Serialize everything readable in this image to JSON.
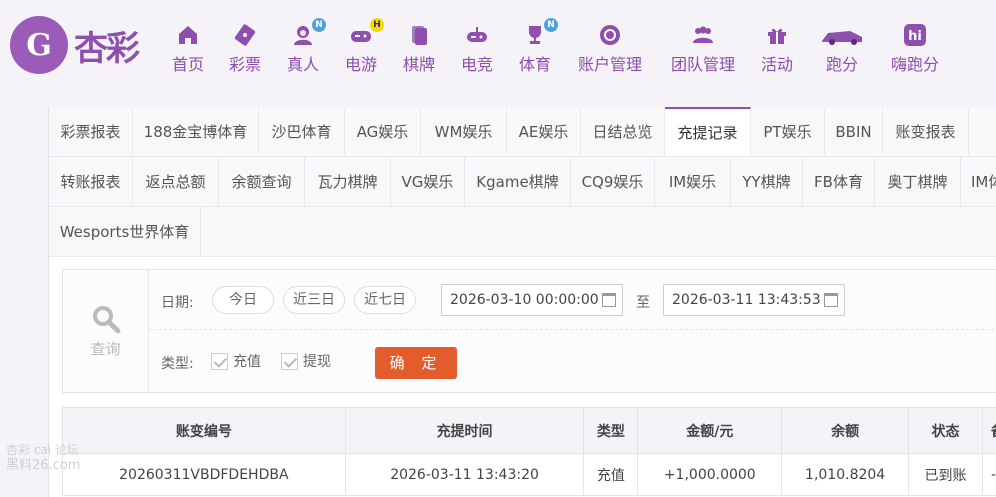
{
  "brand": {
    "name": "杏彩",
    "logo_letter": "G"
  },
  "nav": [
    {
      "label": "首页",
      "icon": "home-icon"
    },
    {
      "label": "彩票",
      "icon": "ticket-icon"
    },
    {
      "label": "真人",
      "icon": "dealer-icon",
      "badge": "N"
    },
    {
      "label": "电游",
      "icon": "gamepad-icon",
      "badge": "H"
    },
    {
      "label": "棋牌",
      "icon": "cards-icon"
    },
    {
      "label": "电竞",
      "icon": "controller-icon"
    },
    {
      "label": "体育",
      "icon": "trophy-icon",
      "badge": "N"
    },
    {
      "label": "账户管理",
      "icon": "account-icon"
    },
    {
      "label": "团队管理",
      "icon": "team-icon"
    },
    {
      "label": "活动",
      "icon": "gift-icon"
    },
    {
      "label": "跑分",
      "icon": "car-icon"
    },
    {
      "label": "嗨跑分",
      "icon": "hi-icon"
    }
  ],
  "tabs_row1": [
    "彩票报表",
    "188金宝博体育",
    "沙巴体育",
    "AG娱乐",
    "WM娱乐",
    "AE娱乐",
    "日结总览",
    "充提记录",
    "PT娱乐",
    "BBIN",
    "账变报表"
  ],
  "tabs_row2": [
    "转账报表",
    "返点总额",
    "余额查询",
    "瓦力棋牌",
    "VG娱乐",
    "Kgame棋牌",
    "CQ9娱乐",
    "IM娱乐",
    "YY棋牌",
    "FB体育",
    "奥丁棋牌",
    "IM体"
  ],
  "tabs_row3": [
    "Wesports世界体育"
  ],
  "active_tab": "充提记录",
  "query": {
    "icon_label": "查询",
    "date_label": "日期:",
    "quick": [
      "今日",
      "近三日",
      "近七日"
    ],
    "start": "2026-03-10 00:00:00",
    "to": "至",
    "end": "2026-03-11 13:43:53",
    "type_label": "类型:",
    "types": [
      "充值",
      "提现"
    ],
    "confirm": "确 定"
  },
  "table": {
    "headers": [
      "账变编号",
      "充提时间",
      "类型",
      "金额/元",
      "余额",
      "状态",
      "备"
    ],
    "rows": [
      [
        "20260311VBDFDEHDBA",
        "2026-03-11 13:43:20",
        "充值",
        "+1,000.0000",
        "1,010.8204",
        "已到账",
        "-"
      ]
    ]
  },
  "watermark": {
    "line1": "杏彩 cai 论坛",
    "line2": "黑料26.com"
  },
  "colors": {
    "brand": "#8e4fae",
    "confirm": "#e35c2b",
    "amount": "#d0262d",
    "status_ok": "#3aa53a"
  }
}
